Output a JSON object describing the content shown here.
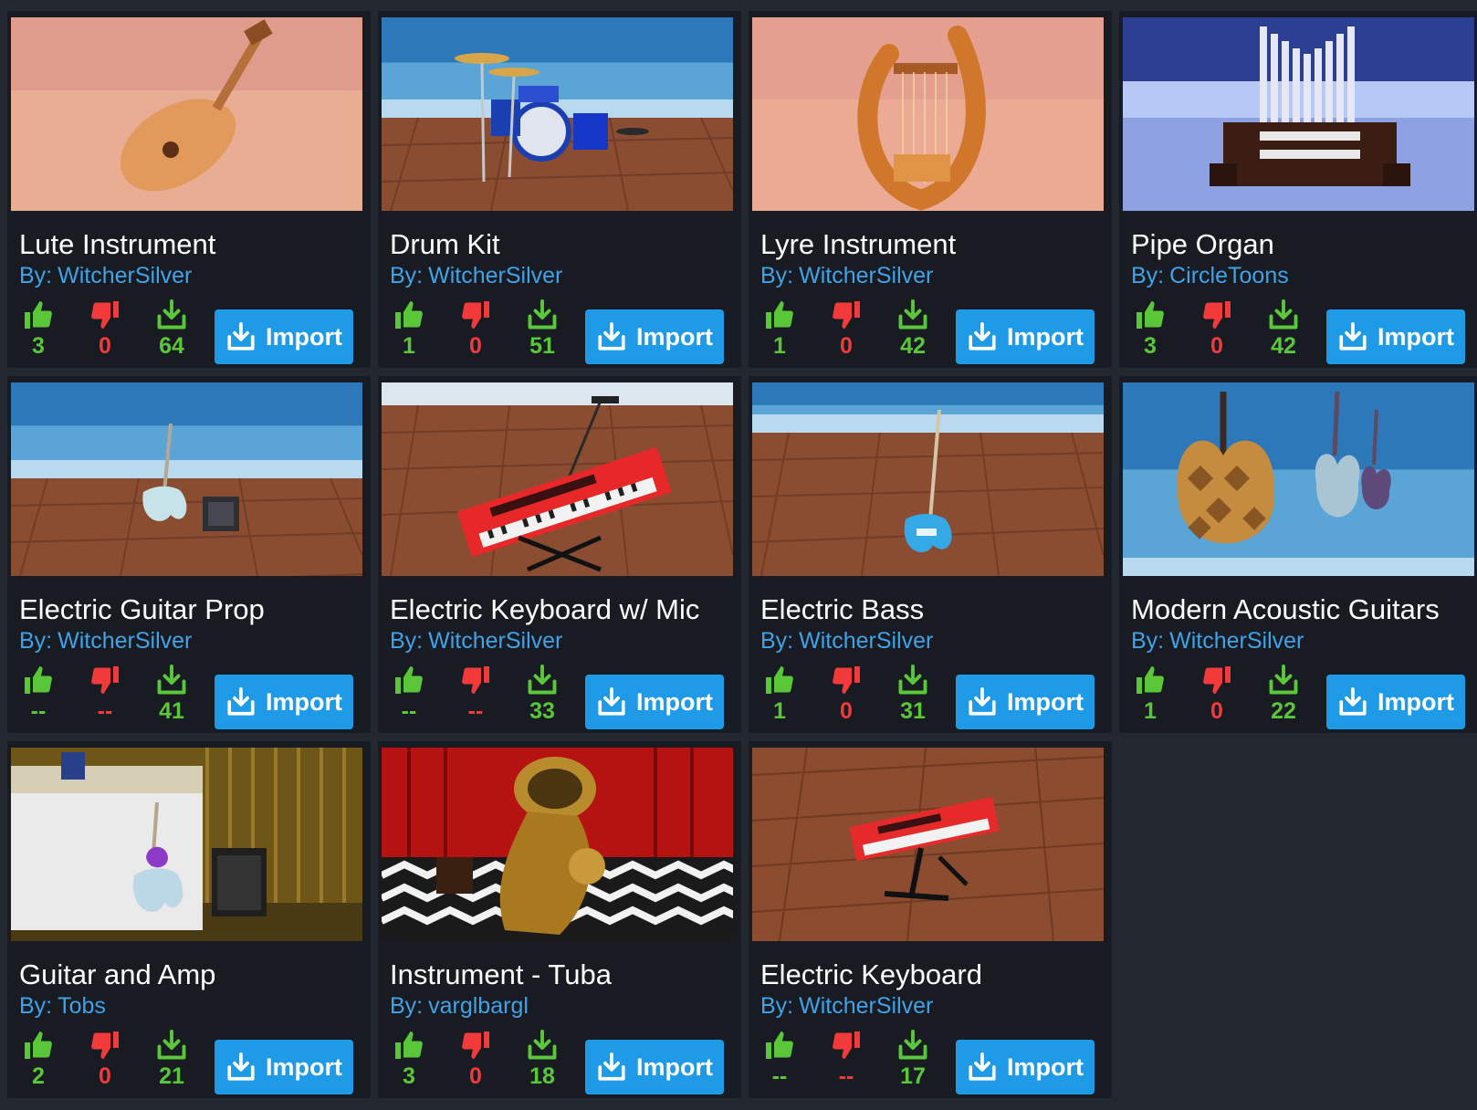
{
  "colors": {
    "page_bg": "#23272f",
    "card_bg": "#181b21",
    "author": "#3fa3e9",
    "like": "#5ac63a",
    "dislike": "#f23a3a",
    "download": "#5ac63a",
    "import_button": "#1e9ae6"
  },
  "labels": {
    "by_prefix": "By:",
    "import": "Import"
  },
  "items": [
    {
      "title": "Lute Instrument",
      "author": "WitcherSilver",
      "likes": "3",
      "dislikes": "0",
      "downloads": "64",
      "thumb": "lute-thumbnail"
    },
    {
      "title": "Drum Kit",
      "author": "WitcherSilver",
      "likes": "1",
      "dislikes": "0",
      "downloads": "51",
      "thumb": "drum-kit-thumbnail"
    },
    {
      "title": "Lyre Instrument",
      "author": "WitcherSilver",
      "likes": "1",
      "dislikes": "0",
      "downloads": "42",
      "thumb": "lyre-thumbnail"
    },
    {
      "title": "Pipe Organ",
      "author": "CircleToons",
      "likes": "3",
      "dislikes": "0",
      "downloads": "42",
      "thumb": "pipe-organ-thumbnail"
    },
    {
      "title": "Electric Guitar Prop",
      "author": "WitcherSilver",
      "likes": "--",
      "dislikes": "--",
      "downloads": "41",
      "thumb": "electric-guitar-thumbnail"
    },
    {
      "title": "Electric Keyboard w/ Mic",
      "author": "WitcherSilver",
      "likes": "--",
      "dislikes": "--",
      "downloads": "33",
      "thumb": "keyboard-mic-thumbnail"
    },
    {
      "title": "Electric Bass",
      "author": "WitcherSilver",
      "likes": "1",
      "dislikes": "0",
      "downloads": "31",
      "thumb": "electric-bass-thumbnail"
    },
    {
      "title": "Modern Acoustic Guitars",
      "author": "WitcherSilver",
      "likes": "1",
      "dislikes": "0",
      "downloads": "22",
      "thumb": "acoustic-guitars-thumbnail"
    },
    {
      "title": "Guitar and Amp",
      "author": "Tobs",
      "likes": "2",
      "dislikes": "0",
      "downloads": "21",
      "thumb": "guitar-amp-thumbnail"
    },
    {
      "title": "Instrument - Tuba",
      "author": "varglbargl",
      "likes": "3",
      "dislikes": "0",
      "downloads": "18",
      "thumb": "tuba-thumbnail"
    },
    {
      "title": "Electric Keyboard",
      "author": "WitcherSilver",
      "likes": "--",
      "dislikes": "--",
      "downloads": "17",
      "thumb": "electric-keyboard-thumbnail"
    }
  ]
}
